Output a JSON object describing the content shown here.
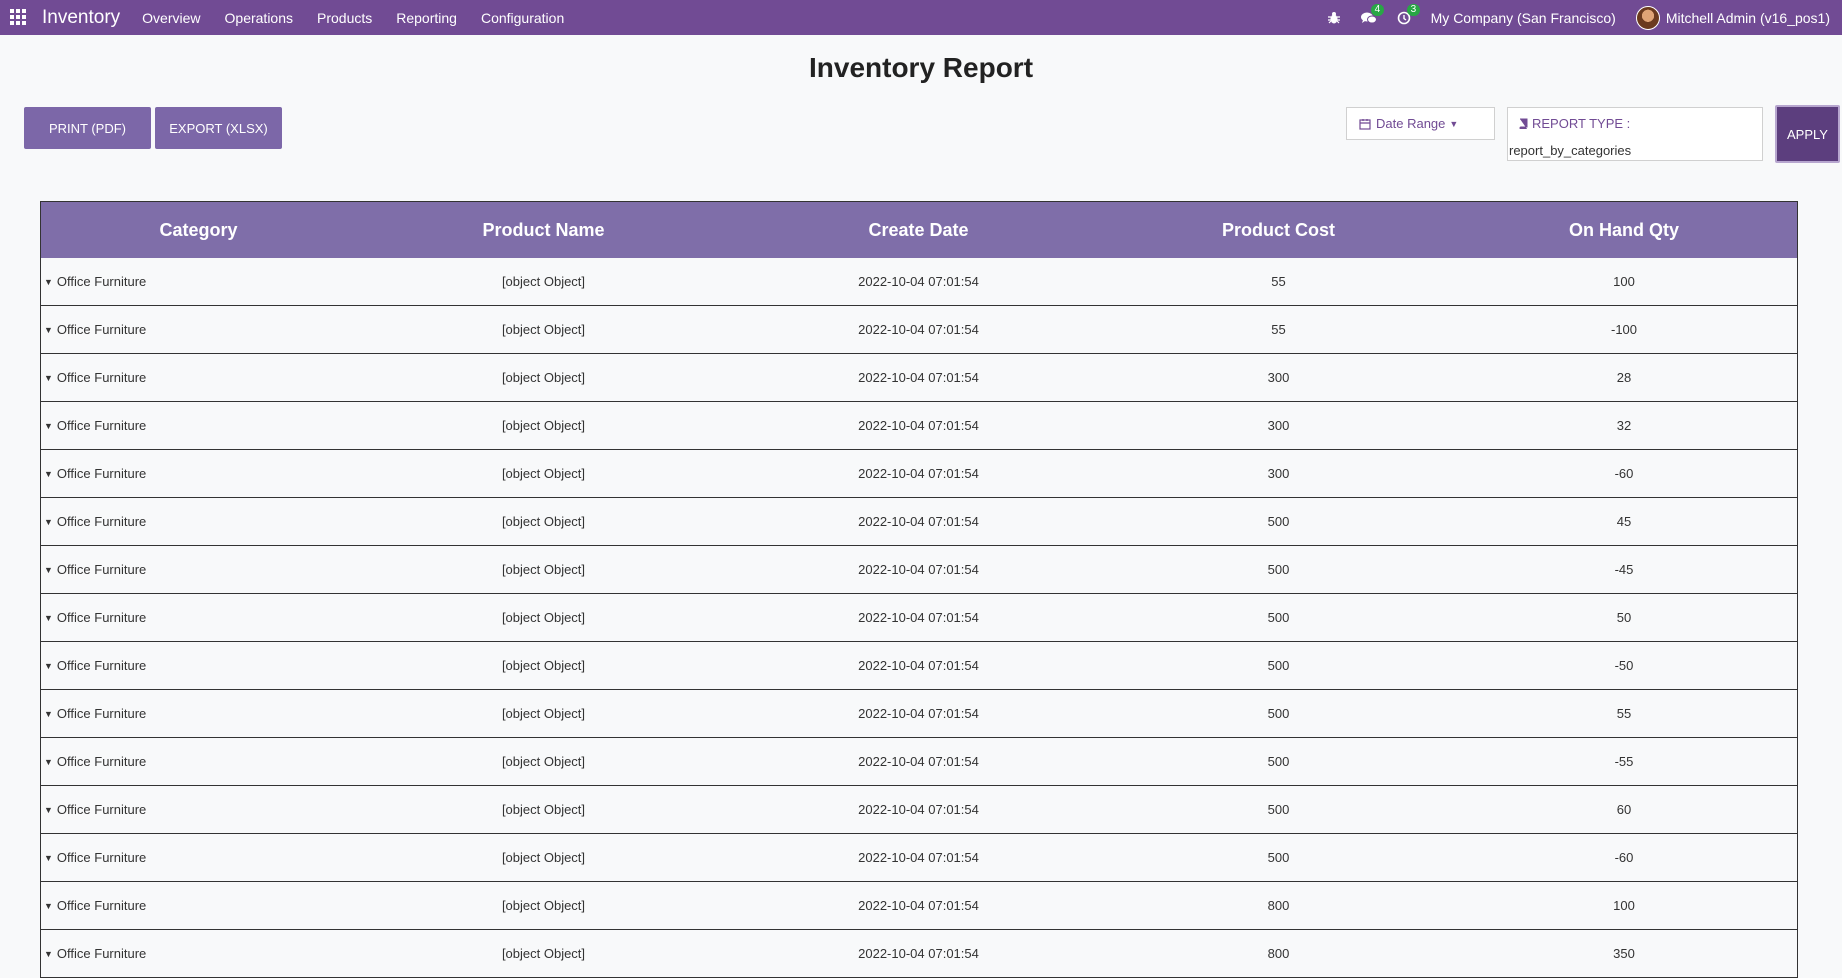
{
  "navbar": {
    "brand": "Inventory",
    "menu": [
      "Overview",
      "Operations",
      "Products",
      "Reporting",
      "Configuration"
    ],
    "messages_count": "4",
    "activities_count": "3",
    "company": "My Company (San Francisco)",
    "user": "Mitchell Admin (v16_pos1)"
  },
  "page": {
    "title": "Inventory Report",
    "print_label": "PRINT (PDF)",
    "export_label": "EXPORT (XLSX)",
    "date_range_label": "Date Range",
    "report_type_label": "REPORT TYPE :",
    "report_type_value": "report_by_categories",
    "apply_label": "APPLY"
  },
  "table": {
    "headers": [
      "Category",
      "Product Name",
      "Create Date",
      "Product Cost",
      "On Hand Qty"
    ],
    "rows": [
      [
        "Office Furniture",
        "[object Object]",
        "2022-10-04 07:01:54",
        "55",
        "100"
      ],
      [
        "Office Furniture",
        "[object Object]",
        "2022-10-04 07:01:54",
        "55",
        "-100"
      ],
      [
        "Office Furniture",
        "[object Object]",
        "2022-10-04 07:01:54",
        "300",
        "28"
      ],
      [
        "Office Furniture",
        "[object Object]",
        "2022-10-04 07:01:54",
        "300",
        "32"
      ],
      [
        "Office Furniture",
        "[object Object]",
        "2022-10-04 07:01:54",
        "300",
        "-60"
      ],
      [
        "Office Furniture",
        "[object Object]",
        "2022-10-04 07:01:54",
        "500",
        "45"
      ],
      [
        "Office Furniture",
        "[object Object]",
        "2022-10-04 07:01:54",
        "500",
        "-45"
      ],
      [
        "Office Furniture",
        "[object Object]",
        "2022-10-04 07:01:54",
        "500",
        "50"
      ],
      [
        "Office Furniture",
        "[object Object]",
        "2022-10-04 07:01:54",
        "500",
        "-50"
      ],
      [
        "Office Furniture",
        "[object Object]",
        "2022-10-04 07:01:54",
        "500",
        "55"
      ],
      [
        "Office Furniture",
        "[object Object]",
        "2022-10-04 07:01:54",
        "500",
        "-55"
      ],
      [
        "Office Furniture",
        "[object Object]",
        "2022-10-04 07:01:54",
        "500",
        "60"
      ],
      [
        "Office Furniture",
        "[object Object]",
        "2022-10-04 07:01:54",
        "500",
        "-60"
      ],
      [
        "Office Furniture",
        "[object Object]",
        "2022-10-04 07:01:54",
        "800",
        "100"
      ],
      [
        "Office Furniture",
        "[object Object]",
        "2022-10-04 07:01:54",
        "800",
        "350"
      ]
    ]
  }
}
